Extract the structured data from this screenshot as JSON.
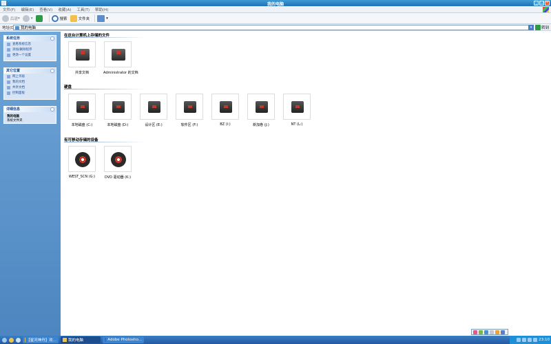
{
  "window": {
    "title": "我的电脑"
  },
  "menu": [
    "文件(F)",
    "编辑(E)",
    "查看(V)",
    "收藏(A)",
    "工具(T)",
    "帮助(H)"
  ],
  "toolbar": {
    "back": "后退",
    "search": "搜索",
    "folders": "文件夹"
  },
  "address": {
    "label": "地址(D)",
    "value": "我的电脑",
    "go": "转到"
  },
  "sidebar": {
    "system_tasks": {
      "title": "系统任务",
      "items": [
        "查看系统信息",
        "添加/删除程序",
        "更改一个设置"
      ]
    },
    "other_places": {
      "title": "其它位置",
      "items": [
        "网上邻居",
        "我的文档",
        "共享文档",
        "控制面板"
      ]
    },
    "details": {
      "title": "详细信息",
      "name": "我的电脑",
      "type": "系统文件夹"
    }
  },
  "groups": {
    "stored_files": {
      "title": "在这台计算机上存储的文件",
      "items": [
        "共享文档",
        "Administrator 的文档"
      ]
    },
    "hard_disks": {
      "title": "硬盘",
      "items": [
        "本地磁盘 (C:)",
        "本地磁盘 (D:)",
        "设计区 (E:)",
        "软件区 (F:)",
        "BZ (I:)",
        "新加卷 (J:)",
        "NT (L:)"
      ]
    },
    "removable": {
      "title": "有可移动存储的设备",
      "items": [
        "WEST_SCN (G:)",
        "DVD 驱动器 (K:)"
      ]
    }
  },
  "taskbar": {
    "tasks": [
      "【星河神舟】欢...",
      "我的电脑",
      "Adobe Photosho..."
    ],
    "clock": "23:10"
  }
}
